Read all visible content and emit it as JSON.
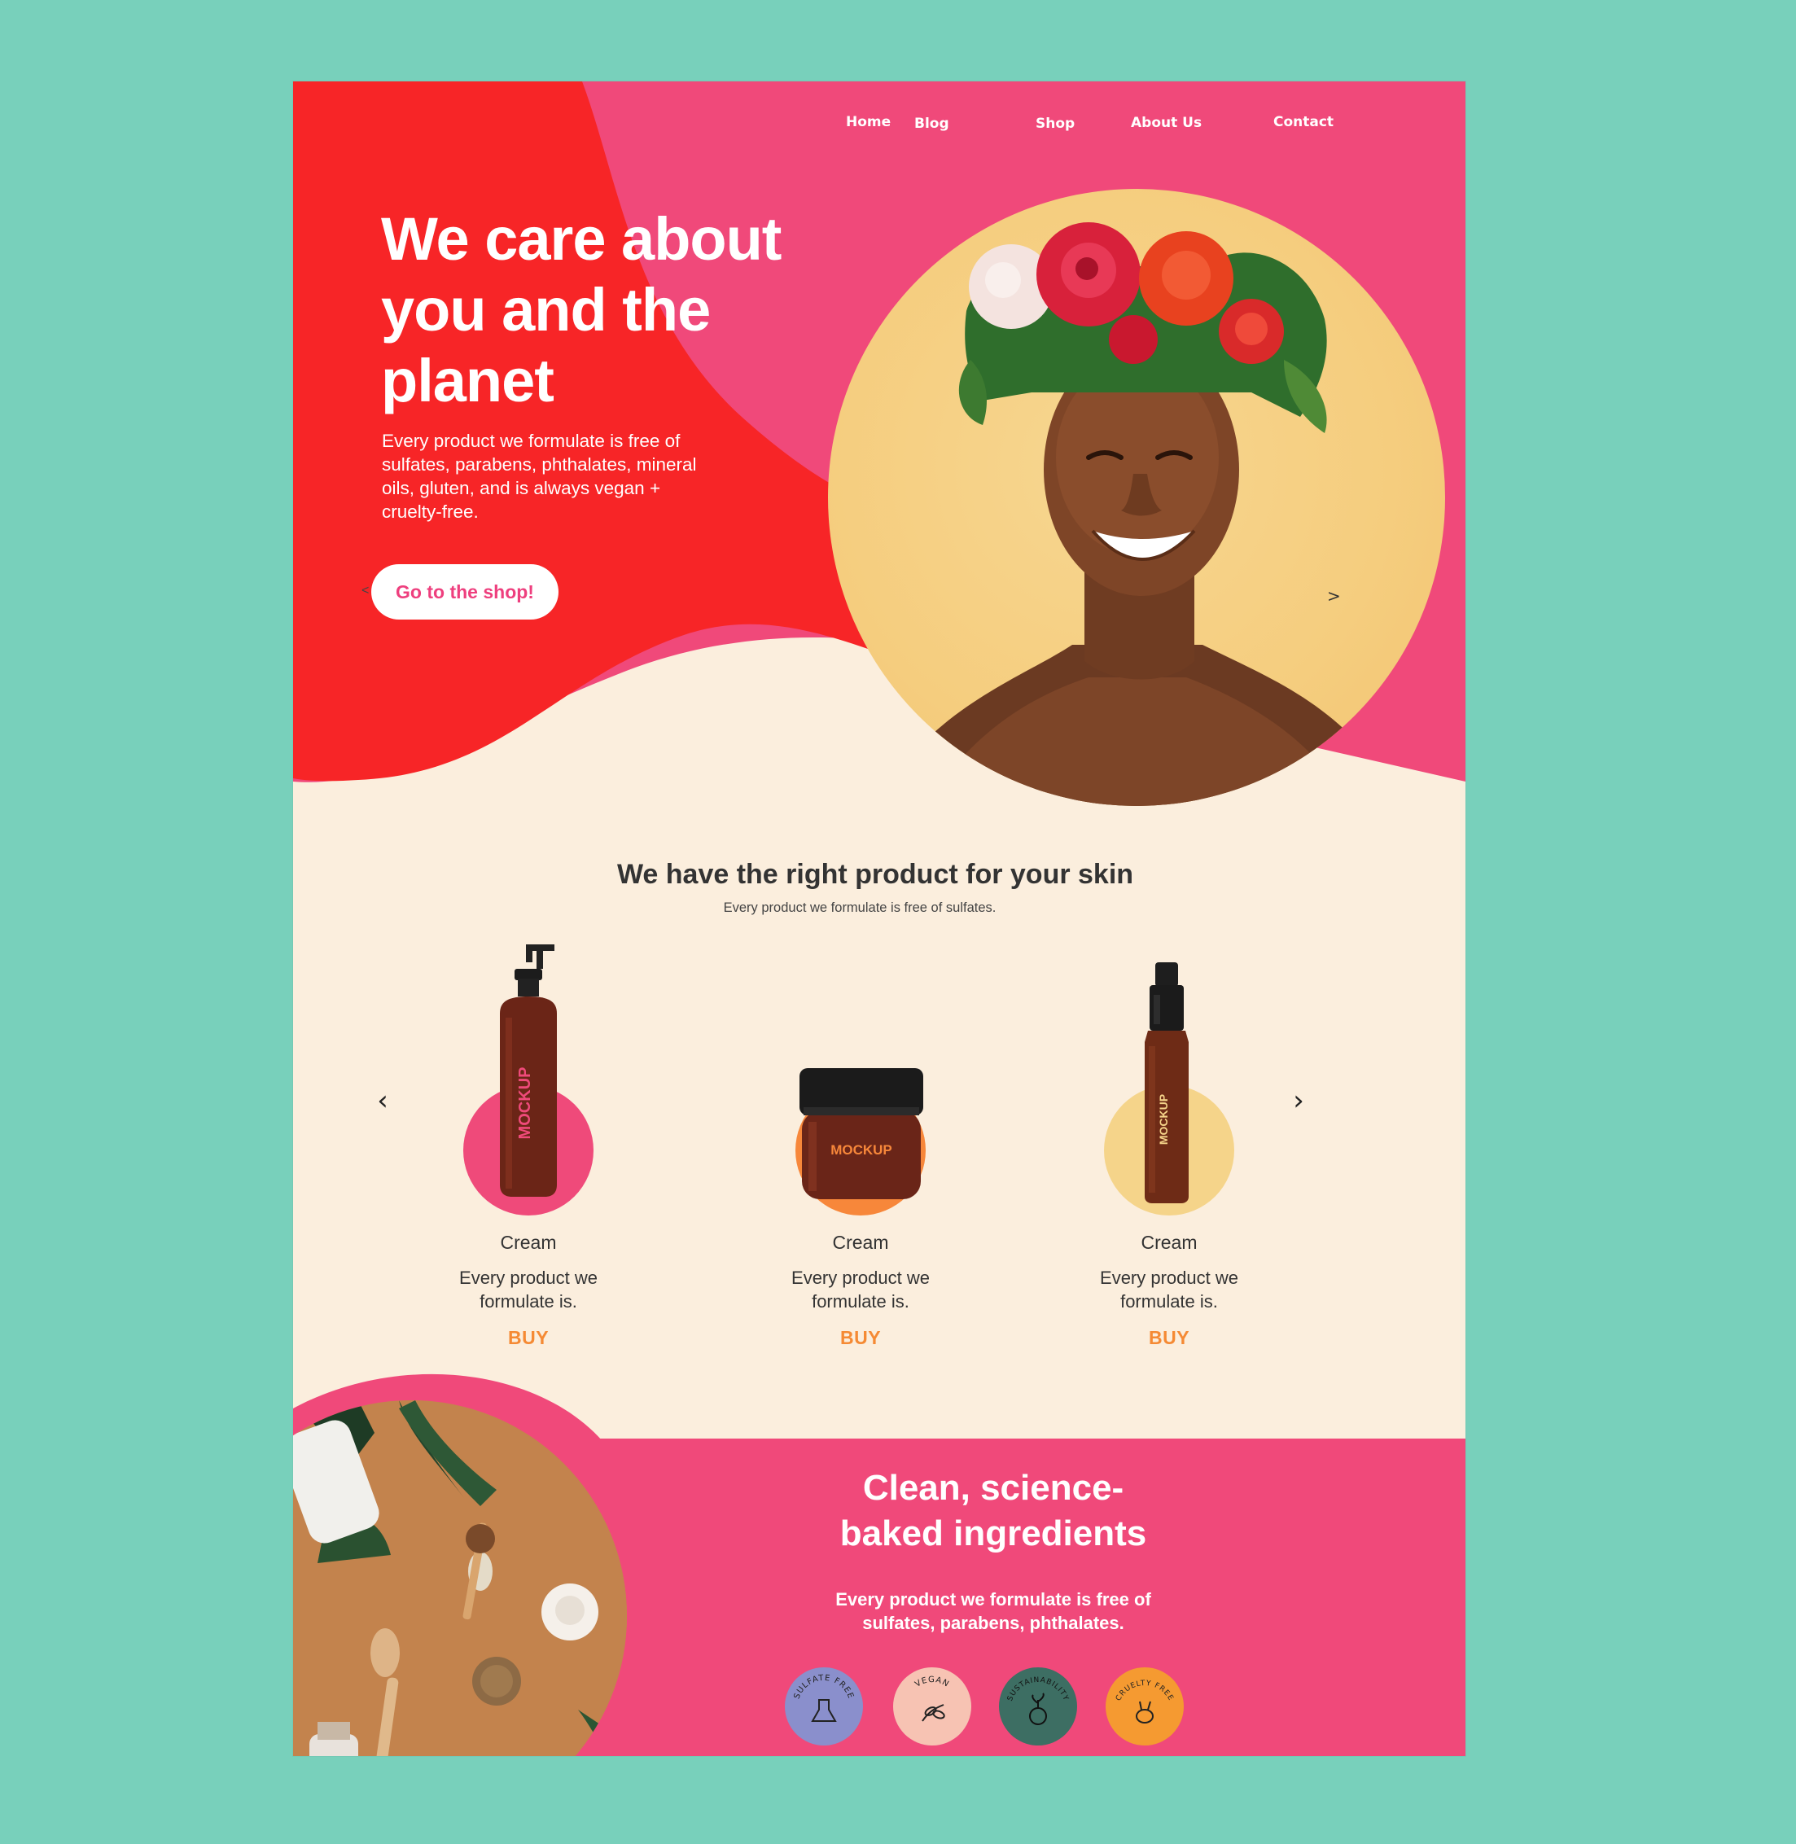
{
  "nav": {
    "home": "Home",
    "blog": "Blog",
    "shop": "Shop",
    "about": "About Us",
    "contact": "Contact"
  },
  "hero": {
    "title_line1": "We care about",
    "title_line2": "you and the",
    "title_line3": "planet",
    "text": "Every product we formulate is free of sulfates, parabens, phthalates, mineral oils, gluten, and is always vegan + cruelty-free.",
    "cta": "Go to the shop!",
    "arrow_left": "<",
    "arrow_right": ">"
  },
  "products": {
    "title": "We have the right product for your skin",
    "subtitle": "Every product we formulate is free of sulfates.",
    "prev_icon": "‹",
    "next_icon": "›",
    "items": [
      {
        "name": "Cream",
        "desc": "Every product we formulate is.",
        "buy": "BUY",
        "label": "MOCKUP",
        "circle_color": "#ef4a7a"
      },
      {
        "name": "Cream",
        "desc": "Every product we formulate is.",
        "buy": "BUY",
        "label": "MOCKUP",
        "circle_color": "#f7873a"
      },
      {
        "name": "Cream",
        "desc": "Every product we formulate is.",
        "buy": "BUY",
        "label": "MOCKUP",
        "circle_color": "#f5d48a"
      }
    ]
  },
  "ingredients": {
    "title_line1": "Clean, science-",
    "title_line2": "baked ingredients",
    "text": "Every product we formulate is free of sulfates, parabens, phthalates.",
    "badges": [
      {
        "label": "SULFATE FREE",
        "icon": "flask-icon",
        "color": "#8a8fcc"
      },
      {
        "label": "VEGAN",
        "icon": "leaf-icon",
        "color": "#f7c3b3"
      },
      {
        "label": "SUSTAINABILITY",
        "icon": "plant-globe-icon",
        "color": "#3d6e63"
      },
      {
        "label": "CRUELTY FREE",
        "icon": "rabbit-icon",
        "color": "#f59a31"
      }
    ]
  },
  "colors": {
    "background": "#78d0bb",
    "red": "#f72527",
    "pink": "#f0497a",
    "cream": "#fbeedd",
    "orange": "#f58a34"
  }
}
